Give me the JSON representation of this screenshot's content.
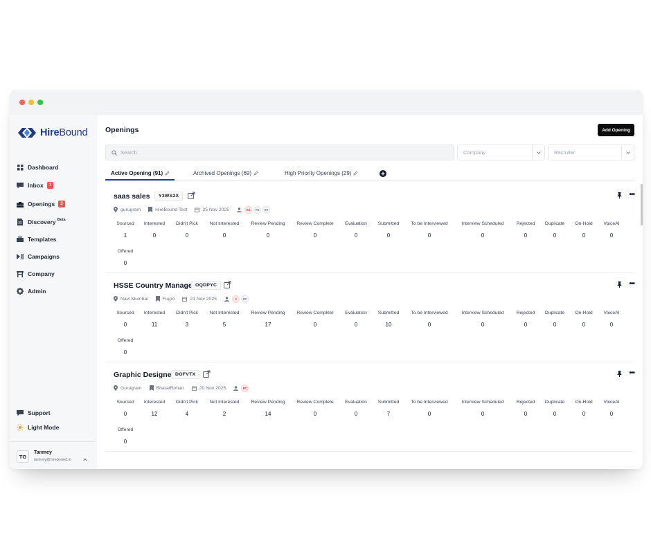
{
  "brand": {
    "name_prefix": "Hire",
    "name_suffix": "Bound",
    "colors": {
      "primary": "#1e3a8a",
      "badge": "#ef5350"
    }
  },
  "sidebar": {
    "items": [
      {
        "label": "Dashboard",
        "icon": "grid-icon",
        "badge": ""
      },
      {
        "label": "Inbox",
        "icon": "chat-icon",
        "badge": "7"
      },
      {
        "label": "Openings",
        "icon": "briefcase-icon",
        "badge": "3"
      },
      {
        "label": "Discovery",
        "icon": "document-icon",
        "badge": "",
        "sup": "Beta"
      },
      {
        "label": "Templates",
        "icon": "template-icon",
        "badge": ""
      },
      {
        "label": "Campaigns",
        "icon": "play-pause-icon",
        "badge": ""
      },
      {
        "label": "Company",
        "icon": "building-icon",
        "badge": ""
      },
      {
        "label": "Admin",
        "icon": "gear-icon",
        "badge": ""
      }
    ],
    "support": "Support",
    "light_mode": "Light Mode",
    "user": {
      "initials": "TG",
      "name": "Tanmey",
      "email": "tanmey@hirebound.io"
    }
  },
  "header": {
    "title": "Openings",
    "add_button": "Add Opening"
  },
  "filters": {
    "search_placeholder": "Search",
    "company_placeholder": "Company",
    "recruiter_placeholder": "Recruiter"
  },
  "tabs": [
    {
      "label": "Active Opening (91)"
    },
    {
      "label": "Archived Openings (69)"
    },
    {
      "label": "High Priority Openings (29)"
    }
  ],
  "stat_labels": [
    "Sourced",
    "Interested",
    "Didn't Pick",
    "Not Interested",
    "Review Pending",
    "Review Complete",
    "Evaluation",
    "Submitted",
    "To be Interviewed",
    "Interview Scheduled",
    "Rejected",
    "Duplicate",
    "On-Hold",
    "VoiceAI",
    "Offered"
  ],
  "openings": [
    {
      "title": "saas sales",
      "code": "Y3WS2X",
      "location": "gurugram",
      "client": "HireBound Test",
      "date": "25 Nov 2025",
      "recruiters": [
        "AC",
        "TG",
        "SV"
      ],
      "stats": [
        "1",
        "0",
        "0",
        "0",
        "0",
        "0",
        "0",
        "0",
        "0",
        "0",
        "0",
        "0",
        "0",
        "0",
        "0"
      ]
    },
    {
      "title": "HSSE Country Manager",
      "code": "OQDPYC",
      "location": "Navi Mumbai",
      "client": "Fugro",
      "date": "21 Nov 2025",
      "recruiters": [
        "J",
        "PC"
      ],
      "stats": [
        "0",
        "11",
        "3",
        "5",
        "17",
        "0",
        "0",
        "10",
        "0",
        "0",
        "0",
        "0",
        "0",
        "0",
        "0"
      ]
    },
    {
      "title": "Graphic Designer",
      "code": "DOFVTX",
      "location": "Gurugram",
      "client": "BharatRohan",
      "date": "20 Nov 2025",
      "recruiters": [
        "PC"
      ],
      "stats": [
        "0",
        "12",
        "4",
        "2",
        "14",
        "0",
        "0",
        "7",
        "0",
        "0",
        "0",
        "0",
        "0",
        "0",
        "0"
      ]
    }
  ]
}
